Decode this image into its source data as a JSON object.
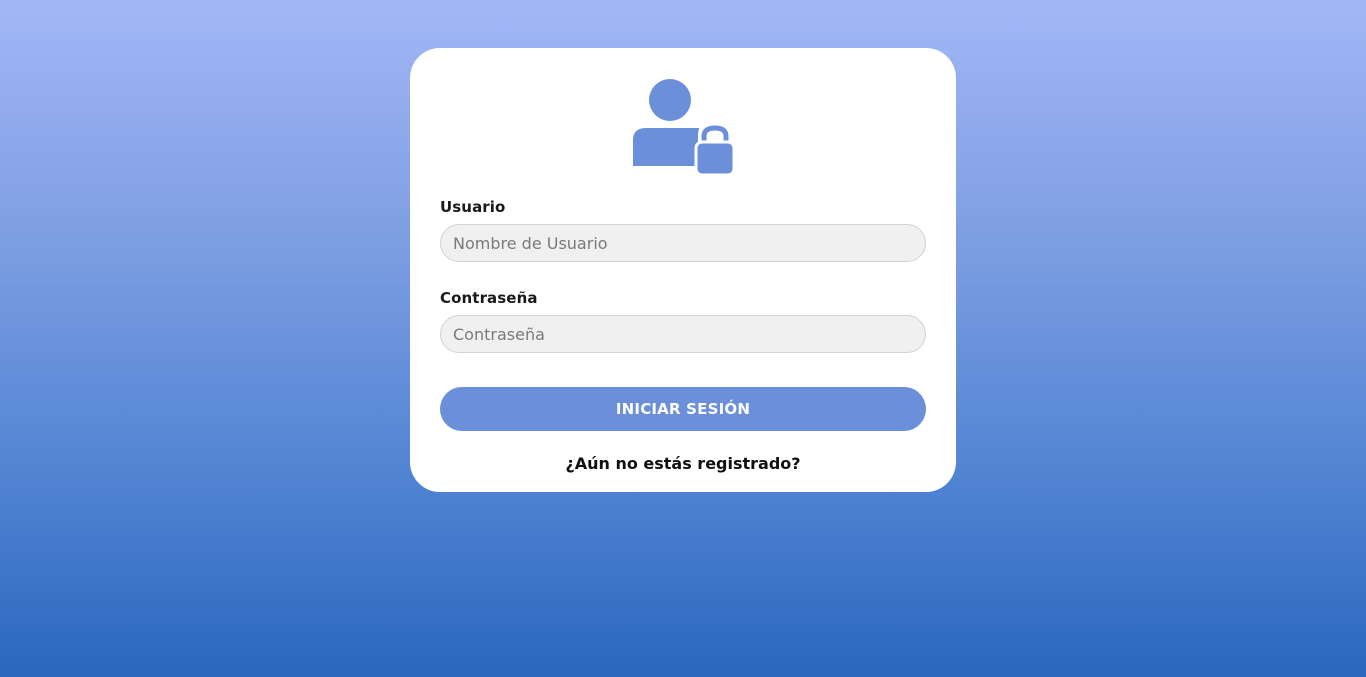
{
  "colors": {
    "accent": "#6b8fd8",
    "card_background": "#ffffff",
    "input_background": "#f0f0f0",
    "background_top": "#a2b7f6",
    "background_bottom": "#2b67bd"
  },
  "login_form": {
    "icon": "user-lock-icon",
    "username": {
      "label": "Usuario",
      "placeholder": "Nombre de Usuario",
      "value": ""
    },
    "password": {
      "label": "Contraseña",
      "placeholder": "Contraseña",
      "value": ""
    },
    "submit_label": "INICIAR SESIÓN",
    "register_link": "¿Aún no estás registrado?"
  }
}
